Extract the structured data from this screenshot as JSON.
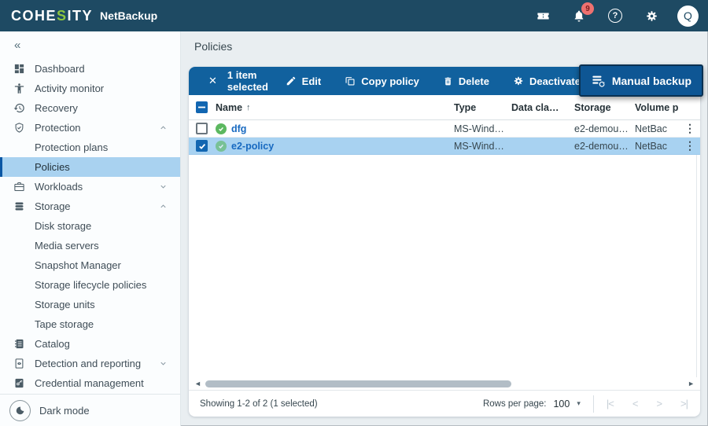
{
  "colors": {
    "header_bg": "#1e4a63",
    "toolbar_bg": "#11619e",
    "manual_backup_bg": "#0e5694",
    "selection_bg": "#a8d2f1",
    "link_blue": "#1769c0",
    "logo_green": "#8dc63f",
    "badge_red": "#ee7170",
    "status_green": "#5cb860"
  },
  "header": {
    "logo_prefix": "COHE",
    "logo_green_letter": "S",
    "logo_suffix": "ITY",
    "product": "NetBackup",
    "notification_count": "9",
    "help_glyph": "?",
    "avatar_initial": "Q"
  },
  "glyphs": {
    "collapse": "«",
    "close": "✕",
    "sort_asc": "↑",
    "kebab": "⋮",
    "dropdown_caret": "▾",
    "scroll_left": "◄",
    "scroll_right": "►",
    "page_first": "|<",
    "page_prev": "<",
    "page_next": ">",
    "page_last": ">|"
  },
  "sidebar": {
    "items": [
      {
        "label": "Dashboard"
      },
      {
        "label": "Activity monitor"
      },
      {
        "label": "Recovery"
      },
      {
        "label": "Protection",
        "expanded": true
      },
      {
        "label": "Protection plans"
      },
      {
        "label": "Policies",
        "selected": true
      },
      {
        "label": "Workloads",
        "expanded": false
      },
      {
        "label": "Storage",
        "expanded": true
      },
      {
        "label": "Disk storage"
      },
      {
        "label": "Media servers"
      },
      {
        "label": "Snapshot Manager"
      },
      {
        "label": "Storage lifecycle policies"
      },
      {
        "label": "Storage units"
      },
      {
        "label": "Tape storage"
      },
      {
        "label": "Catalog"
      },
      {
        "label": "Detection and reporting",
        "expanded": false
      },
      {
        "label": "Credential management"
      }
    ],
    "dark_mode_label": "Dark mode"
  },
  "page": {
    "title": "Policies"
  },
  "toolbar": {
    "selected_text": "1 item selected",
    "edit_label": "Edit",
    "copy_label": "Copy policy",
    "delete_label": "Delete",
    "deactivate_label": "Deactivate",
    "manual_backup_label": "Manual backup"
  },
  "table": {
    "columns": {
      "name": "Name",
      "type": "Type",
      "data_class": "Data cla…",
      "storage": "Storage",
      "volume": "Volume p"
    },
    "rows": [
      {
        "name": "dfg",
        "type": "MS-Wind…",
        "data_class": "",
        "storage": "e2-demou…",
        "volume": "NetBac",
        "selected": false
      },
      {
        "name": "e2-policy",
        "type": "MS-Wind…",
        "data_class": "",
        "storage": "e2-demou…",
        "volume": "NetBac",
        "selected": true
      }
    ]
  },
  "footer": {
    "showing_text": "Showing 1-2 of 2 (1 selected)",
    "rows_per_page_label": "Rows per page:",
    "rows_per_page_value": "100"
  }
}
